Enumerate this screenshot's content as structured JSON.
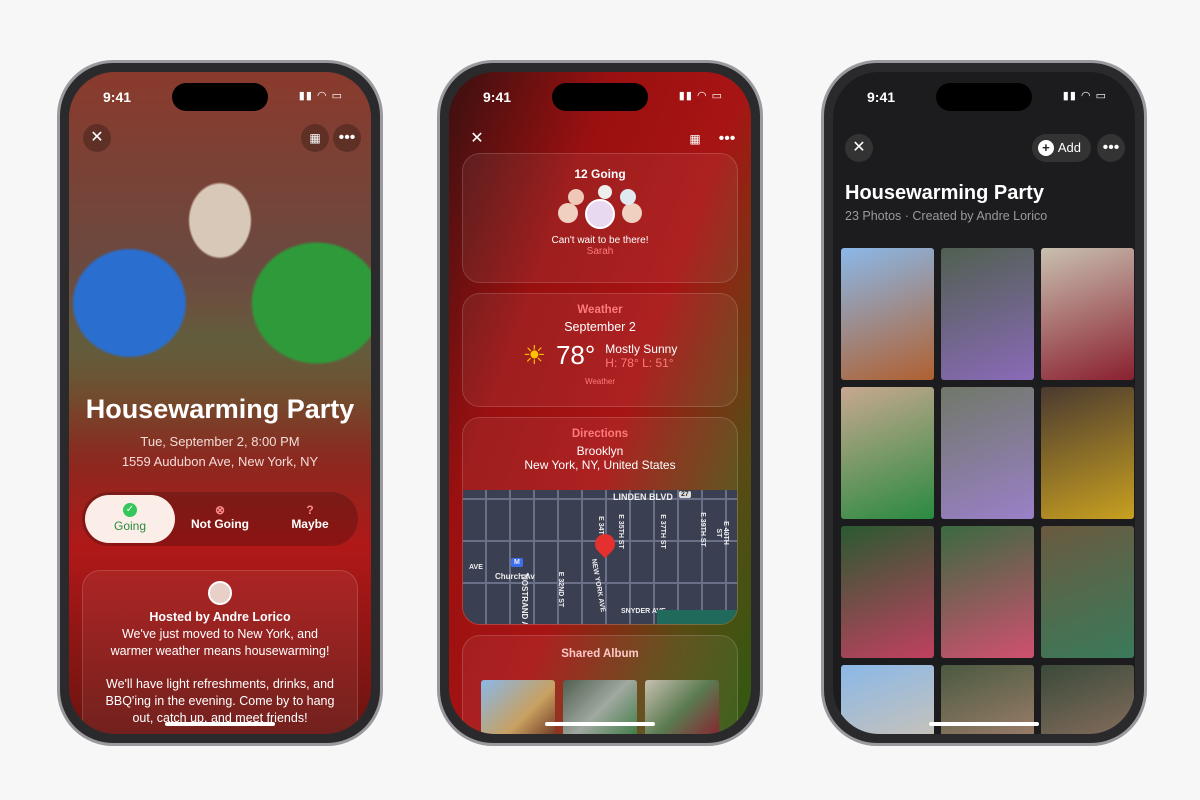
{
  "status": {
    "time": "9:41"
  },
  "invite": {
    "title": "Housewarming Party",
    "date": "Tue, September 2, 8:00 PM",
    "address": "1559 Audubon Ave, New York, NY",
    "rsvp": [
      {
        "label": "Going",
        "icon": "check-circle-icon"
      },
      {
        "label": "Not Going",
        "icon": "x-circle-icon"
      },
      {
        "label": "Maybe",
        "icon": "question-circle-icon"
      }
    ],
    "host": "Hosted by Andre Lorico",
    "message1": "We've just moved to New York, and warmer weather means housewarming!",
    "message2": "We'll have light refreshments, drinks, and BBQ'ing in the evening. Come by to hang out, catch up, and meet friends!"
  },
  "details": {
    "going": "12 Going",
    "comment": "Can't wait to be there!",
    "commenter": "Sarah",
    "weather": {
      "label": "Weather",
      "date": "September 2",
      "temp": "78°",
      "condition": "Mostly Sunny",
      "hilo": "H: 78° L: 51°",
      "source": "Weather"
    },
    "directions": {
      "label": "Directions",
      "place": "Brooklyn",
      "region": "New York, NY, United States"
    },
    "map": {
      "linden": "LINDEN BLVD",
      "route": "27",
      "station": "Church Av",
      "snyder": "SNYDER AVE",
      "ave": "AVE",
      "ny": "NEW YORK AVE",
      "nostrand": "NOSTRAND A",
      "e32": "E 32ND ST",
      "e34": "E 34T",
      "e35": "E 35TH ST",
      "e37": "E 37TH ST",
      "e39": "E 39TH ST",
      "e40": "E 40TH ST"
    },
    "album": "Shared Album"
  },
  "album": {
    "add": "Add",
    "title": "Housewarming Party",
    "subtitle": "23 Photos · Created by Andre Lorico"
  },
  "colors": {
    "accent_red": "#ff7b7b",
    "going_green": "#34c759"
  }
}
